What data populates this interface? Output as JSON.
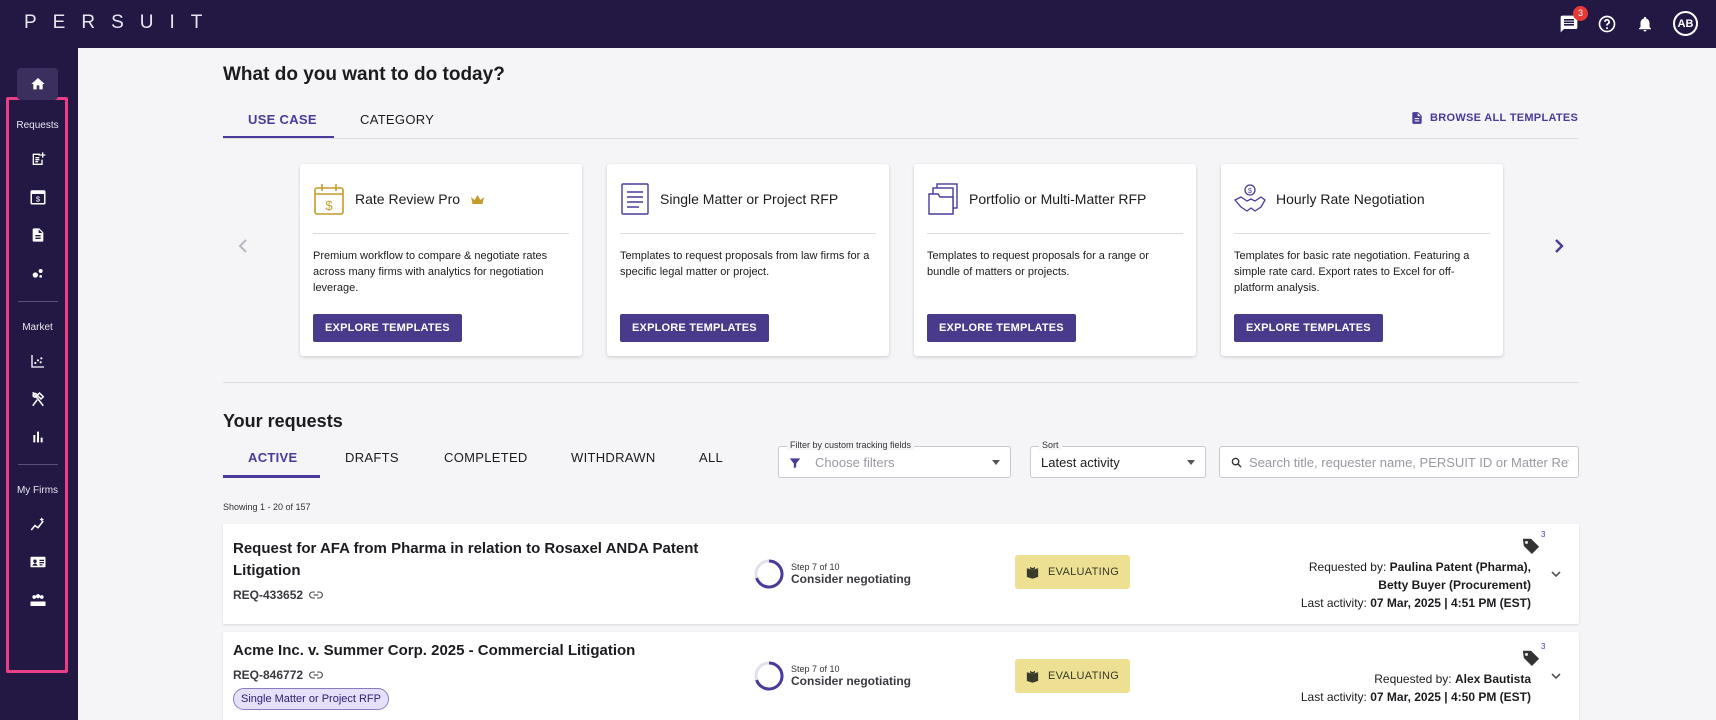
{
  "app": {
    "logo": "PERSUIT"
  },
  "topbar": {
    "chat_badge": "3",
    "avatar_initials": "AB"
  },
  "sidebar": {
    "sections": {
      "requests": "Requests",
      "market": "Market",
      "my_firms": "My Firms"
    }
  },
  "main": {
    "heading": "What do you want to do today?",
    "template_tabs": [
      "USE CASE",
      "CATEGORY"
    ],
    "browse_label": "BROWSE ALL TEMPLATES",
    "cards": [
      {
        "title": "Rate Review Pro",
        "desc": "Premium workflow to compare & negotiate rates across many firms with analytics for negotiation leverage.",
        "button": "EXPLORE TEMPLATES"
      },
      {
        "title": "Single Matter or Project RFP",
        "desc": "Templates to request proposals from law firms for a specific legal matter or project.",
        "button": "EXPLORE TEMPLATES"
      },
      {
        "title": "Portfolio or Multi-Matter RFP",
        "desc": "Templates to request proposals for a range or bundle of matters or projects.",
        "button": "EXPLORE TEMPLATES"
      },
      {
        "title": "Hourly Rate Negotiation",
        "desc": "Templates for basic rate negotiation. Featuring a simple rate card. Export rates to Excel for off-platform analysis.",
        "button": "EXPLORE TEMPLATES"
      }
    ],
    "requests_heading": "Your requests",
    "request_tabs": [
      "ACTIVE",
      "DRAFTS",
      "COMPLETED",
      "WITHDRAWN",
      "ALL"
    ],
    "filter": {
      "label": "Filter by custom tracking fields",
      "placeholder": "Choose filters"
    },
    "sort": {
      "label": "Sort",
      "value": "Latest activity"
    },
    "search": {
      "placeholder": "Search title, requester name, PERSUIT ID or Matter Ref"
    },
    "showing": "Showing 1 - 20 of 157",
    "requests": [
      {
        "title": "Request for AFA from Pharma in relation to Rosaxel ANDA Patent Litigation",
        "id": "REQ-433652",
        "step_small": "Step 7 of 10",
        "step_label": "Consider negotiating",
        "status": "EVALUATING",
        "tag_count": "3",
        "requested_by_label": "Requested by:",
        "requested_by": "Paulina Patent (Pharma),",
        "requested_by_2": "Betty Buyer (Procurement)",
        "last_activity_label": "Last activity:",
        "last_activity": "07 Mar, 2025 | 4:51 PM (EST)"
      },
      {
        "title": "Acme Inc. v. Summer Corp. 2025 - Commercial Litigation",
        "id": "REQ-846772",
        "chip": "Single Matter or Project RFP",
        "step_small": "Step 7 of 10",
        "step_label": "Consider negotiating",
        "status": "EVALUATING",
        "tag_count": "3",
        "requested_by_label": "Requested by:",
        "requested_by": "Alex Bautista",
        "last_activity_label": "Last activity:",
        "last_activity": "07 Mar, 2025 | 4:50 PM (EST)"
      }
    ]
  }
}
